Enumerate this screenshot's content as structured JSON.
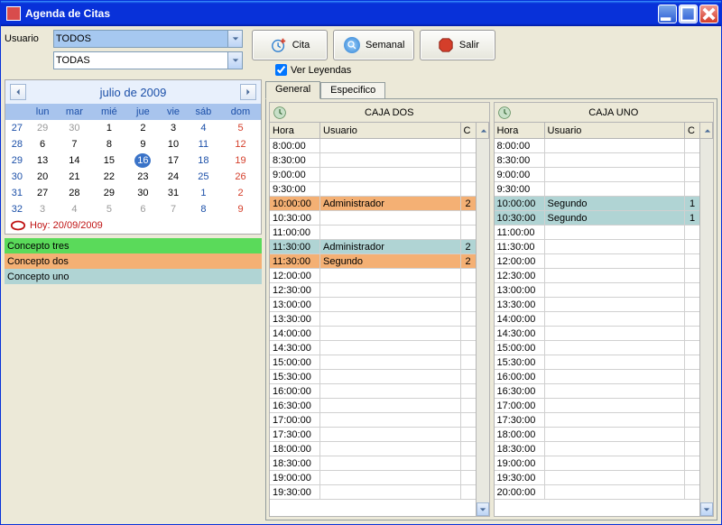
{
  "window": {
    "title": "Agenda de Citas"
  },
  "toolbar": {
    "usuario_label": "Usuario",
    "usuario_value": "TODOS",
    "second_value": "TODAS",
    "cita": "Cita",
    "semanal": "Semanal",
    "salir": "Salir",
    "ver_leyendas": "Ver Leyendas"
  },
  "calendar": {
    "title": "julio de 2009",
    "day_headers": [
      "lun",
      "mar",
      "mié",
      "jue",
      "vie",
      "sáb",
      "dom"
    ],
    "weeks": [
      {
        "wk": "27",
        "days": [
          {
            "d": "29",
            "cls": "other"
          },
          {
            "d": "30",
            "cls": "other"
          },
          {
            "d": "1"
          },
          {
            "d": "2"
          },
          {
            "d": "3"
          },
          {
            "d": "4",
            "cls": "sat"
          },
          {
            "d": "5",
            "cls": "sun"
          }
        ]
      },
      {
        "wk": "28",
        "days": [
          {
            "d": "6"
          },
          {
            "d": "7"
          },
          {
            "d": "8"
          },
          {
            "d": "9"
          },
          {
            "d": "10"
          },
          {
            "d": "11",
            "cls": "sat"
          },
          {
            "d": "12",
            "cls": "sun"
          }
        ]
      },
      {
        "wk": "29",
        "days": [
          {
            "d": "13"
          },
          {
            "d": "14"
          },
          {
            "d": "15"
          },
          {
            "d": "16",
            "cls": "sel"
          },
          {
            "d": "17"
          },
          {
            "d": "18",
            "cls": "sat"
          },
          {
            "d": "19",
            "cls": "sun"
          }
        ]
      },
      {
        "wk": "30",
        "days": [
          {
            "d": "20"
          },
          {
            "d": "21"
          },
          {
            "d": "22"
          },
          {
            "d": "23"
          },
          {
            "d": "24"
          },
          {
            "d": "25",
            "cls": "sat"
          },
          {
            "d": "26",
            "cls": "sun"
          }
        ]
      },
      {
        "wk": "31",
        "days": [
          {
            "d": "27"
          },
          {
            "d": "28"
          },
          {
            "d": "29"
          },
          {
            "d": "30"
          },
          {
            "d": "31"
          },
          {
            "d": "1",
            "cls": "other sat"
          },
          {
            "d": "2",
            "cls": "other sun"
          }
        ]
      },
      {
        "wk": "32",
        "days": [
          {
            "d": "3",
            "cls": "other"
          },
          {
            "d": "4",
            "cls": "other"
          },
          {
            "d": "5",
            "cls": "other"
          },
          {
            "d": "6",
            "cls": "other"
          },
          {
            "d": "7",
            "cls": "other"
          },
          {
            "d": "8",
            "cls": "other sat"
          },
          {
            "d": "9",
            "cls": "other sun"
          }
        ]
      }
    ],
    "today": "Hoy: 20/09/2009"
  },
  "legends": [
    {
      "label": "Concepto tres",
      "color": "lg-green"
    },
    {
      "label": "Concepto dos",
      "color": "lg-orange"
    },
    {
      "label": "Concepto uno",
      "color": "lg-blue"
    }
  ],
  "tabs": {
    "general": "General",
    "especifico": "Especifico"
  },
  "hora_label": "Hora",
  "usuario_label": "Usuario",
  "c_label": "C",
  "schedules": [
    {
      "title": "CAJA DOS",
      "rows": [
        {
          "hora": "8:00:00"
        },
        {
          "hora": "8:30:00"
        },
        {
          "hora": "9:00:00"
        },
        {
          "hora": "9:30:00"
        },
        {
          "hora": "10:00:00",
          "usuario": "Administrador",
          "c": "2",
          "cls": "orange"
        },
        {
          "hora": "10:30:00"
        },
        {
          "hora": "11:00:00"
        },
        {
          "hora": "11:30:00",
          "usuario": "Administrador",
          "c": "2",
          "cls": "blue"
        },
        {
          "hora": "11:30:00",
          "usuario": "Segundo",
          "c": "2",
          "cls": "orange"
        },
        {
          "hora": "12:00:00"
        },
        {
          "hora": "12:30:00"
        },
        {
          "hora": "13:00:00"
        },
        {
          "hora": "13:30:00"
        },
        {
          "hora": "14:00:00"
        },
        {
          "hora": "14:30:00"
        },
        {
          "hora": "15:00:00"
        },
        {
          "hora": "15:30:00"
        },
        {
          "hora": "16:00:00"
        },
        {
          "hora": "16:30:00"
        },
        {
          "hora": "17:00:00"
        },
        {
          "hora": "17:30:00"
        },
        {
          "hora": "18:00:00"
        },
        {
          "hora": "18:30:00"
        },
        {
          "hora": "19:00:00"
        },
        {
          "hora": "19:30:00"
        }
      ]
    },
    {
      "title": "CAJA UNO",
      "rows": [
        {
          "hora": "8:00:00"
        },
        {
          "hora": "8:30:00"
        },
        {
          "hora": "9:00:00"
        },
        {
          "hora": "9:30:00"
        },
        {
          "hora": "10:00:00",
          "usuario": "Segundo",
          "c": "1",
          "cls": "blue"
        },
        {
          "hora": "10:30:00",
          "usuario": "Segundo",
          "c": "1",
          "cls": "blue"
        },
        {
          "hora": "11:00:00"
        },
        {
          "hora": "11:30:00"
        },
        {
          "hora": "12:00:00"
        },
        {
          "hora": "12:30:00"
        },
        {
          "hora": "13:00:00"
        },
        {
          "hora": "13:30:00"
        },
        {
          "hora": "14:00:00"
        },
        {
          "hora": "14:30:00"
        },
        {
          "hora": "15:00:00"
        },
        {
          "hora": "15:30:00"
        },
        {
          "hora": "16:00:00"
        },
        {
          "hora": "16:30:00"
        },
        {
          "hora": "17:00:00"
        },
        {
          "hora": "17:30:00"
        },
        {
          "hora": "18:00:00"
        },
        {
          "hora": "18:30:00"
        },
        {
          "hora": "19:00:00"
        },
        {
          "hora": "19:30:00"
        },
        {
          "hora": "20:00:00"
        }
      ]
    }
  ]
}
